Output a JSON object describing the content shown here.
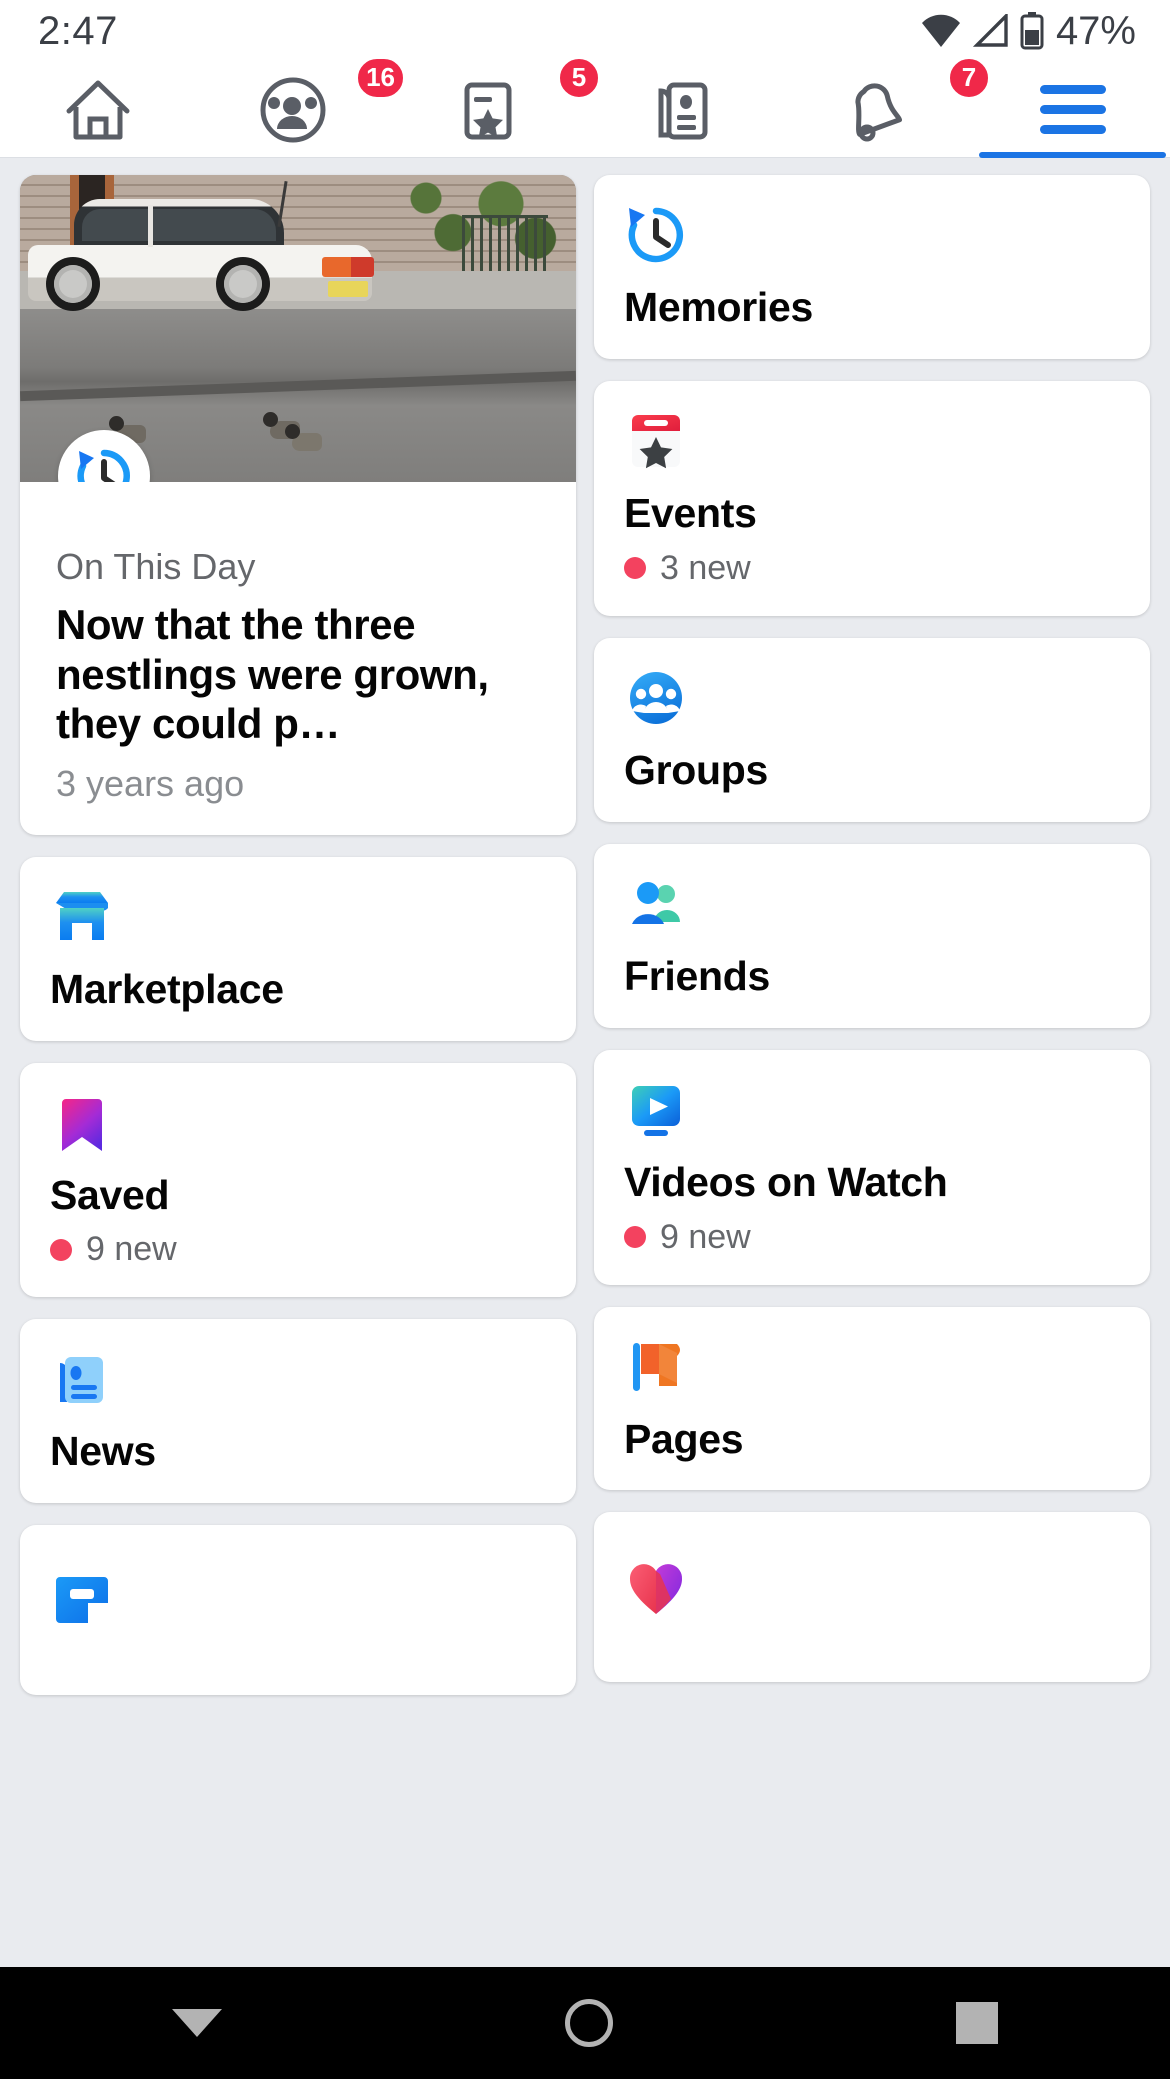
{
  "status_bar": {
    "time": "2:47",
    "battery_percent": "47%",
    "wifi_icon": "wifi-icon",
    "signal_icon": "cellular-signal-icon",
    "battery_icon": "battery-icon"
  },
  "navbar": {
    "tabs": [
      {
        "name": "home",
        "icon": "home-icon",
        "badge": ""
      },
      {
        "name": "groups",
        "icon": "groups-icon",
        "badge": "16"
      },
      {
        "name": "events",
        "icon": "events-calendar-icon",
        "badge": "5"
      },
      {
        "name": "news",
        "icon": "news-icon",
        "badge": ""
      },
      {
        "name": "notifications",
        "icon": "bell-icon",
        "badge": "7"
      },
      {
        "name": "menu",
        "icon": "hamburger-menu-icon",
        "badge": "",
        "active": true
      }
    ]
  },
  "left_column": {
    "memory_card": {
      "eyebrow": "On This Day",
      "title": "Now that the three nestlings were grown, they could p…",
      "time_ago": "3 years ago",
      "badge_icon": "memories-clock-icon",
      "photo_alt": "white sedan parked on a street with pigeons"
    },
    "items": [
      {
        "label": "Marketplace",
        "icon": "marketplace-storefront-icon",
        "badge": ""
      },
      {
        "label": "Saved",
        "icon": "saved-bookmark-icon",
        "badge": "9 new"
      },
      {
        "label": "News",
        "icon": "news-paper-icon",
        "badge": ""
      },
      {
        "label": "",
        "icon": "gaming-icon",
        "badge": ""
      }
    ]
  },
  "right_column": {
    "items": [
      {
        "label": "Memories",
        "icon": "memories-clock-icon",
        "badge": ""
      },
      {
        "label": "Events",
        "icon": "events-calendar-icon",
        "badge": "3 new"
      },
      {
        "label": "Groups",
        "icon": "groups-people-icon",
        "badge": ""
      },
      {
        "label": "Friends",
        "icon": "friends-icon",
        "badge": ""
      },
      {
        "label": "Videos on Watch",
        "icon": "watch-video-icon",
        "badge": "9 new"
      },
      {
        "label": "Pages",
        "icon": "pages-flag-icon",
        "badge": ""
      },
      {
        "label": "",
        "icon": "dating-heart-icon",
        "badge": ""
      }
    ]
  },
  "system_nav": {
    "back": "back-button",
    "home": "home-button",
    "recents": "recents-button"
  },
  "colors": {
    "accent": "#1b74e4",
    "badge_red": "#f02849",
    "dot_red": "#f3425f",
    "background": "#e9ebef",
    "card": "#ffffff",
    "text_primary": "#050505",
    "text_secondary": "#65676b"
  }
}
